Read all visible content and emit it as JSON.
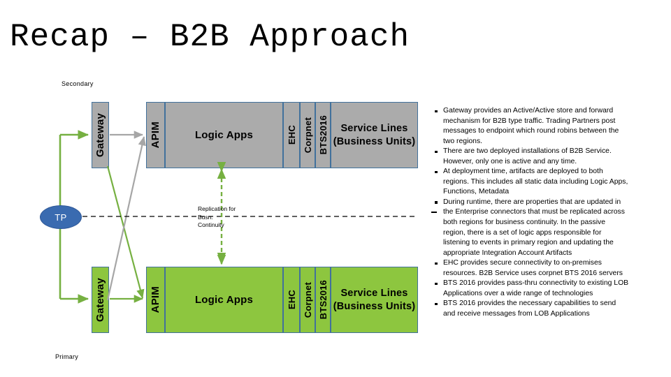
{
  "slide": {
    "title": "Recap – B2B Approach",
    "background": "#FFFFFF"
  },
  "colors": {
    "green_active": "#8DC63F",
    "gray_passive": "#ABABAB",
    "border_blue": "#41719C",
    "oval_blue": "#3A6BB0",
    "arrow_green": "#76B041",
    "arrow_gray": "#A6A6A6",
    "text": "#000000"
  },
  "diagram": {
    "region_labels": {
      "secondary": "Secondary",
      "primary": "Primary"
    },
    "trading_partner": {
      "label": "TP"
    },
    "replication_note": {
      "line1": "Replication for",
      "line2": "Busn.",
      "line3": "Continuity"
    },
    "secondary_row": {
      "state": "passive",
      "fill": "#ABABAB",
      "gateway": "Gateway",
      "apim": "APIM",
      "logic_apps": "Logic Apps",
      "ehc": "EHC",
      "corpnet": "Corpnet",
      "bts": "BTS2016",
      "service_lines_line1": "Service Lines",
      "service_lines_line2": "(Business Units)"
    },
    "primary_row": {
      "state": "active",
      "fill": "#8DC63F",
      "gateway": "Gateway",
      "apim": "APIM",
      "logic_apps": "Logic Apps",
      "ehc": "EHC",
      "corpnet": "Corpnet",
      "bts": "BTS2016",
      "service_lines_line1": "Service Lines",
      "service_lines_line2": "(Business Units)"
    }
  },
  "notes": {
    "bullets": [
      "Gateway provides an Active/Active store and forward mechanism for B2B type traffic.  Trading Partners post messages to endpoint which round robins between the two regions.",
      "There are two deployed installations of B2B Service.  However, only one is active and any time.",
      "At deployment time, artifacts are deployed to both regions.  This includes all static data including Logic Apps, Functions, Metadata",
      "During runtime, there are properties that are updated in the Enterprise connectors that must be replicated across both regions for business continuity.  In the passive region, there is a set of logic apps responsible for listening to events in primary region and updating the appropriate Integration Account Artifacts",
      "EHC provides secure connectivity to on-premises resources.  B2B Service uses corpnet BTS 2016 servers",
      "BTS 2016 provides pass-thru connectivity to existing LOB Applications over a wide range of technologies",
      "BTS 2016 provides the necessary capabilities to send and receive messages from LOB Applications"
    ]
  }
}
